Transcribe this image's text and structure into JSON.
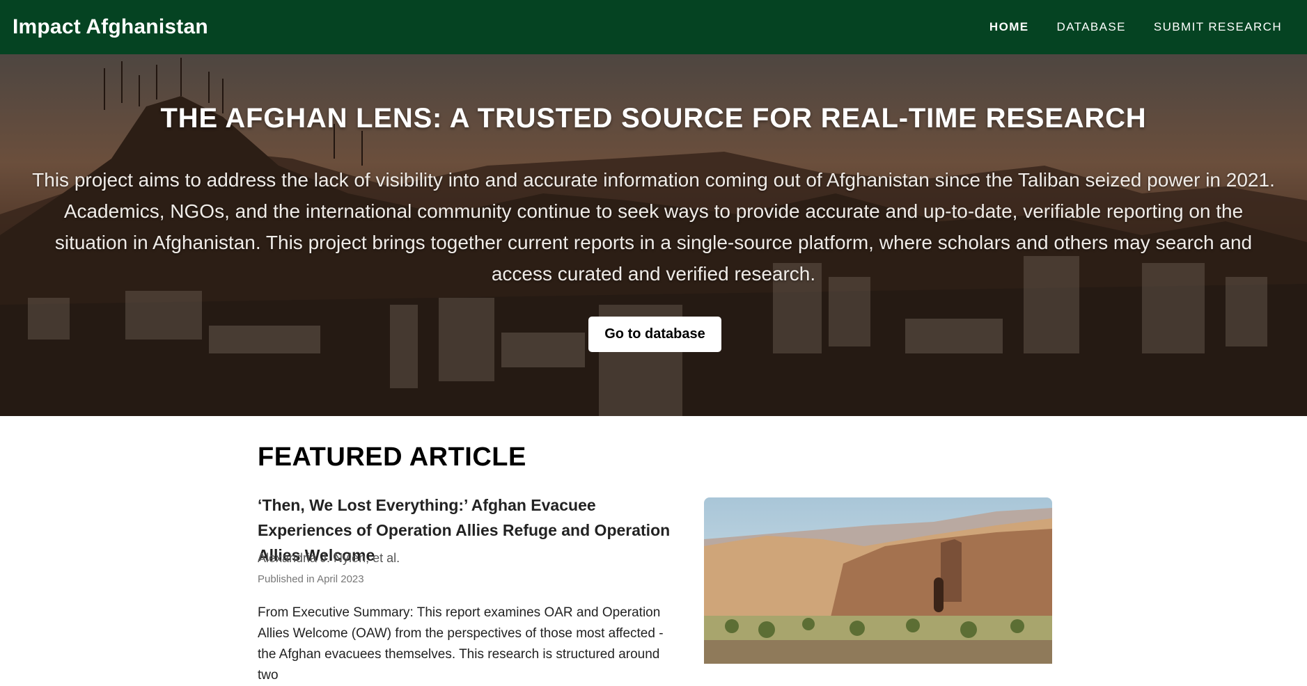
{
  "nav": {
    "brand": "Impact Afghanistan",
    "links": [
      {
        "label": "HOME",
        "active": true
      },
      {
        "label": "DATABASE",
        "active": false
      },
      {
        "label": "SUBMIT RESEARCH",
        "active": false
      }
    ]
  },
  "hero": {
    "title": "THE AFGHAN LENS: A TRUSTED SOURCE FOR REAL-TIME RESEARCH",
    "description": "This project aims to address the lack of visibility into and accurate information coming out of Afghanistan since the Taliban seized power in 2021. Academics, NGOs, and the international community continue to seek ways to provide accurate and up-to-date, verifiable reporting on the situation in Afghanistan. This project brings together current reports in a single-source platform, where scholars and others may search and access curated and verified research.",
    "button_label": "Go to database"
  },
  "featured": {
    "heading": "FEATURED ARTICLE",
    "title": "‘Then, We Lost Everything:’ Afghan Evacuee Experiences of Operation Allies Refuge and Operation Allies Welcome",
    "author": "Alexandria J. Nylen, et al.",
    "published": "Published in April 2023",
    "summary": "From Executive Summary: This report examines OAR and Operation Allies Welcome (OAW) from the perspectives of those most affected - the Afghan evacuees themselves. This research is structured around two"
  },
  "colors": {
    "nav_background": "#054322",
    "hero_text": "#ffffff",
    "button_background": "#ffffff"
  }
}
